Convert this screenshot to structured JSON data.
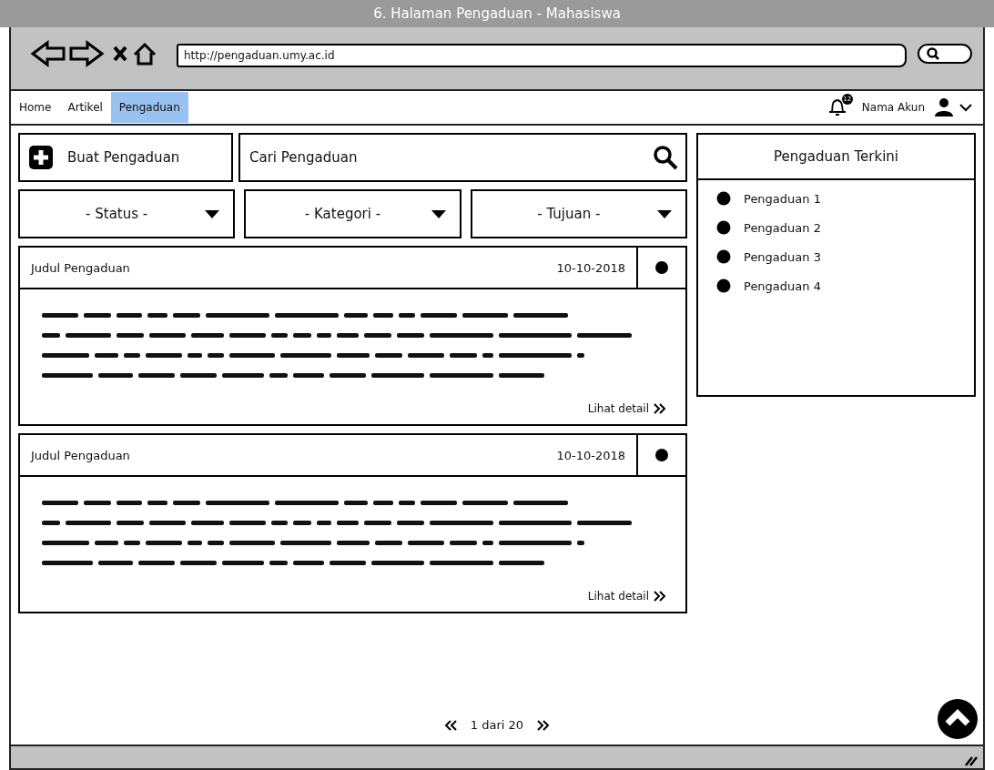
{
  "window": {
    "title": "6. Halaman Pengaduan - Mahasiswa"
  },
  "browser": {
    "url": "http://pengaduan.umy.ac.id"
  },
  "nav": {
    "tabs": [
      {
        "label": "Home",
        "selected": false
      },
      {
        "label": "Artikel",
        "selected": false
      },
      {
        "label": "Pengaduan",
        "selected": true
      }
    ],
    "notification_count": "12",
    "account": "Nama Akun"
  },
  "toolbar": {
    "create_button": "Buat Pengaduan",
    "search": {
      "placeholder": "Cari Pengaduan"
    }
  },
  "filters": [
    {
      "label": "- Status -"
    },
    {
      "label": "- Kategori -"
    },
    {
      "label": "- Tujuan -"
    }
  ],
  "complaints": [
    {
      "title": "Judul Pengaduan",
      "date": "10-10-2018",
      "link": "Lihat detail"
    },
    {
      "title": "Judul Pengaduan",
      "date": "10-10-2018",
      "link": "Lihat detail"
    }
  ],
  "recent": {
    "title": "Pengaduan Terkini",
    "items": [
      "Pengaduan 1",
      "Pengaduan 2",
      "Pengaduan 3",
      "Pengaduan 4"
    ]
  },
  "pagination": {
    "label": "1 dari 20"
  }
}
